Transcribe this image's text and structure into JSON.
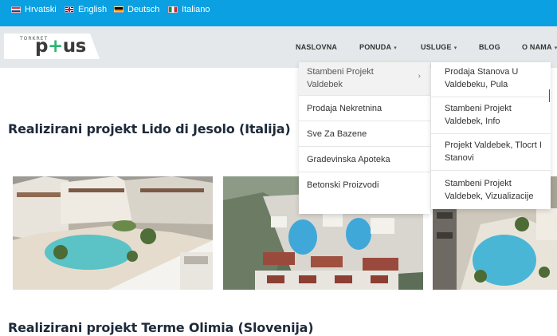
{
  "languages": [
    {
      "label": "Hrvatski",
      "flag": "croatia-flag-icon"
    },
    {
      "label": "English",
      "flag": "uk-flag-icon"
    },
    {
      "label": "Deutsch",
      "flag": "germany-flag-icon"
    },
    {
      "label": "Italiano",
      "flag": "italy-flag-icon"
    }
  ],
  "logo": {
    "top": "TORKRET",
    "main_left": "p",
    "main_plus": "+",
    "main_right": "us"
  },
  "nav": {
    "naslovna": "NASLOVNA",
    "ponuda": "PONUDA",
    "usluge": "USLUGE",
    "blog": "BLOG",
    "o_nama": "O NAMA"
  },
  "dropdown_level1": [
    "Stambeni Projekt Valdebek",
    "Prodaja Nekretnina",
    "Sve Za Bazene",
    "Gradevinska Apoteka",
    "Betonski Proizvodi"
  ],
  "dropdown_level2": [
    "Prodaja Stanova U Valdebeku, Pula",
    "Stambeni Projekt Valdebek, Info",
    "Projekt Valdebek, Tlocrt I Stanovi",
    "Stambeni Projekt Valdebek, Vizualizacije"
  ],
  "sections": [
    {
      "title": "Realizirani projekt Lido di Jesolo (Italija)"
    },
    {
      "title": "Realizirani projekt Terme Olimia (Slovenija)"
    }
  ],
  "colors": {
    "topbar": "#0aa0e2",
    "header": "#e4e8eb",
    "title": "#1e2a3a",
    "logo_plus": "#2bb673"
  },
  "icons": {
    "chevron": "chevron-right-icon",
    "caret": "chevron-down-icon"
  }
}
